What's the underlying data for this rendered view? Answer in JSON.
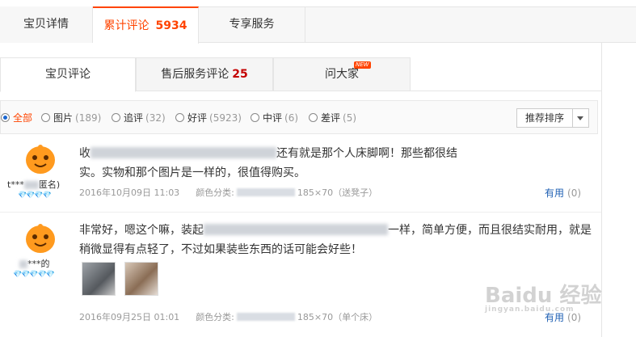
{
  "top_tabs": [
    {
      "label": "宝贝详情"
    },
    {
      "label": "累计评论",
      "count": "5934"
    },
    {
      "label": "专享服务"
    }
  ],
  "sub_tabs": [
    {
      "label": "宝贝评论"
    },
    {
      "label": "售后服务评论",
      "count": "25"
    },
    {
      "label": "问大家",
      "badge": "NEW"
    }
  ],
  "filters": [
    {
      "label": "全部",
      "count": "",
      "selected": true
    },
    {
      "label": "图片",
      "count": "(189)"
    },
    {
      "label": "追评",
      "count": "(32)"
    },
    {
      "label": "好评",
      "count": "(5923)"
    },
    {
      "label": "中评",
      "count": "(6)"
    },
    {
      "label": "差评",
      "count": "(5)"
    }
  ],
  "sort": {
    "label": "推荐排序"
  },
  "reviews": [
    {
      "user": "t***",
      "user_tail": "匿名)",
      "hearts": "💎💎💎💎",
      "text_line1_start": "收",
      "text_line1_end": "还有就是那个人床脚啊！那些都很结",
      "text_line2": "实。实物和那个图片是一样的，很值得购买。",
      "date": "2016年10月09日 11:03",
      "color_label": "颜色分类:",
      "spec": "185×70（送凳子）",
      "useful_label": "有用",
      "useful_count": "(0)"
    },
    {
      "user": "***的",
      "hearts": "💎💎💎💎💎",
      "text_line1_start": "非常好，嗯这个嘛，装起",
      "text_line1_end": "一样，简单方便，而且很结实耐用，就是",
      "text_line2": "稍微显得有点轻了，不过如果装些东西的话可能会好些！",
      "date": "2016年09月25日 01:01",
      "color_label": "颜色分类:",
      "spec": "185×70（单个床）",
      "useful_label": "有用",
      "useful_count": "(0)"
    }
  ],
  "watermark": {
    "brand": "Baidu 经验",
    "url": "jingyan.baidu.com"
  },
  "colors": {
    "accent": "#ff4400",
    "link": "#1e5fb3",
    "count_red": "#c40000"
  }
}
